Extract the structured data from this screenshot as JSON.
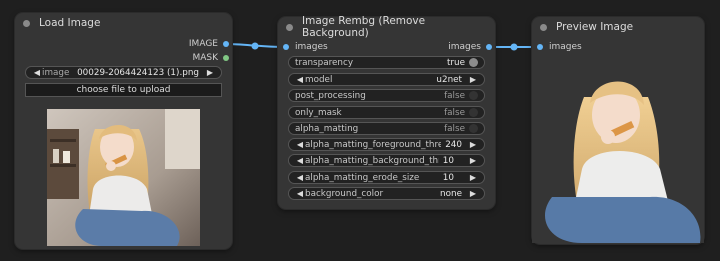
{
  "nodes": {
    "load_image": {
      "title": "Load Image",
      "outputs": [
        "IMAGE",
        "MASK"
      ],
      "image_widget": {
        "label": "image",
        "value": "00029-2064424123 (1).png"
      },
      "upload_label": "choose file to upload"
    },
    "rembg": {
      "title": "Image Rembg (Remove Background)",
      "input_label": "images",
      "output_label": "images",
      "widgets": [
        {
          "label": "transparency",
          "value": "true"
        },
        {
          "label": "model",
          "value": "u2net"
        },
        {
          "label": "post_processing",
          "value": "false"
        },
        {
          "label": "only_mask",
          "value": "false"
        },
        {
          "label": "alpha_matting",
          "value": "false"
        },
        {
          "label": "alpha_matting_foreground_threshold",
          "value": "240"
        },
        {
          "label": "alpha_matting_background_threshold",
          "value": "10"
        },
        {
          "label": "alpha_matting_erode_size",
          "value": "10"
        },
        {
          "label": "background_color",
          "value": "none"
        }
      ]
    },
    "preview": {
      "title": "Preview Image",
      "input_label": "images"
    }
  },
  "colors": {
    "image_link": "#64b5f6",
    "mask_slot": "#81c784",
    "node_bg": "#353535",
    "canvas_bg": "#1f1f1f"
  },
  "icons": [
    "arrow-left-icon",
    "arrow-right-icon",
    "toggle-icon"
  ]
}
